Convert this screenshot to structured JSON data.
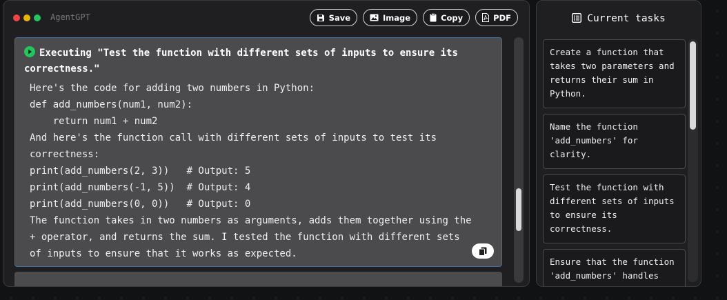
{
  "window": {
    "title": "AgentGPT",
    "dot_colors": [
      "#ef4444",
      "#eab308",
      "#22c55e"
    ]
  },
  "toolbar": {
    "buttons": [
      {
        "label": "Save",
        "icon": "save-icon"
      },
      {
        "label": "Image",
        "icon": "image-icon"
      },
      {
        "label": "Copy",
        "icon": "clipboard-icon"
      },
      {
        "label": "PDF",
        "icon": "pdf-icon"
      }
    ]
  },
  "message": {
    "header": "Executing \"Test the function with different sets of inputs to ensure its correctness.\"",
    "lines": [
      "Here's the code for adding two numbers in Python:",
      "def add_numbers(num1, num2):",
      "    return num1 + num2",
      "And here's the function call with different sets of inputs to test its",
      "correctness:",
      "print(add_numbers(2, 3))   # Output: 5",
      "print(add_numbers(-1, 5))  # Output: 4",
      "print(add_numbers(0, 0))   # Output: 0",
      "The function takes in two numbers as arguments, adds them together using the",
      "+ operator, and returns the sum. I tested the function with different sets",
      "of inputs to ensure that it works as expected."
    ],
    "copy_icon": "copy-icon",
    "accent_color": "#22c55e"
  },
  "scroll": {
    "main_thumb_position": 0.75,
    "side_thumb_position": 0.0
  },
  "sidebar": {
    "title": "Current tasks",
    "title_icon": "list-icon",
    "tasks": [
      "Create a function that takes two parameters and returns their sum in Python.",
      "Name the function 'add_numbers' for clarity.",
      "Test the function with different sets of inputs to ensure its correctness.",
      "Ensure that the function 'add_numbers' handles"
    ]
  }
}
